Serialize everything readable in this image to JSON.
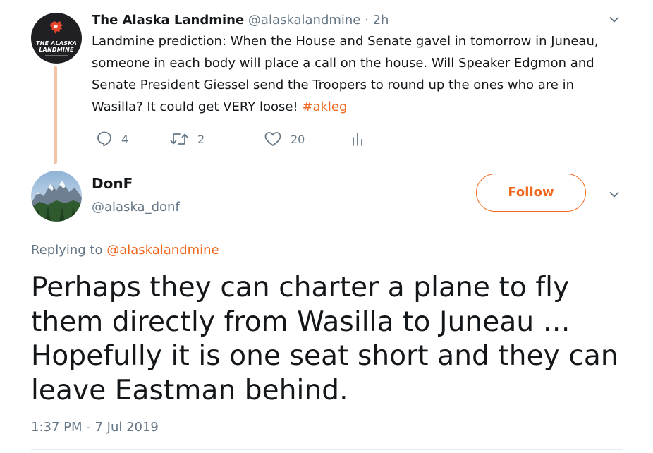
{
  "parent_tweet": {
    "author_name": "The Alaska Landmine",
    "handle": "@alaskalandmine",
    "separator": "·",
    "time_ago": "2h",
    "avatar_text": "THE ALASKA LANDMINE",
    "text_plain": "Landmine prediction: When the House and Senate gavel in tomorrow in Juneau, someone in each body will place a call on the house. Will Speaker Edgmon and Senate President Giessel send the Troopers to round up the ones who are in Wasilla? It could get VERY loose! ",
    "hashtag": "#akleg",
    "stats": {
      "replies": "4",
      "retweets": "2",
      "likes": "20"
    },
    "icons": [
      "reply-icon",
      "retweet-icon",
      "like-icon",
      "analytics-icon",
      "chevron-down-icon"
    ]
  },
  "focused_tweet": {
    "author_name": "DonF",
    "handle": "@alaska_donf",
    "follow_label": "Follow",
    "replying_prefix": "Replying to ",
    "replying_to": "@alaskalandmine",
    "text": "Perhaps they can charter a plane to fly them directly from Wasilla to Juneau … Hopefully it is one seat short and they can leave Eastman behind.",
    "timestamp": "1:37 PM - 7 Jul 2019"
  },
  "colors": {
    "accent": "#f0691f",
    "thread_line": "#f3c3a7",
    "text": "#14171a",
    "muted": "#657786",
    "divider": "#e6ecf0"
  }
}
